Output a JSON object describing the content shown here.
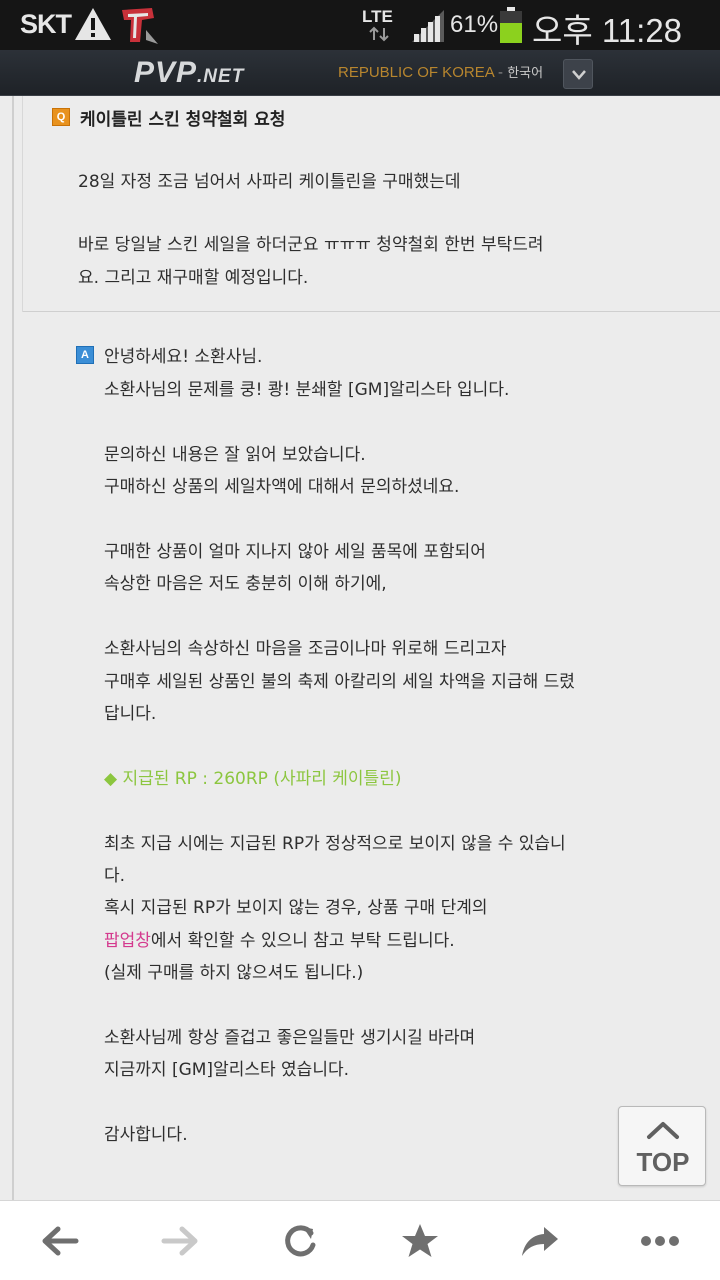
{
  "status_bar": {
    "carrier": "SKT",
    "network": "LTE",
    "battery_percent": "61%",
    "time": "오후 11:28"
  },
  "site_header": {
    "logo_main": "PVP",
    "logo_sub": ".NET",
    "region": "REPUBLIC OF KOREA",
    "separator": " - ",
    "language": "한국어"
  },
  "question": {
    "icon_letter": "Q",
    "title": "케이틀린 스킨 청약철회 요청",
    "paragraphs": [
      "28일 자정 조금 넘어서 사파리 케이틀린을 구매했는데",
      "바로 당일날 스킨 세일을 하더군요 ㅠㅠㅠ 청약철회 한번 부탁드려",
      "요. 그리고 재구매할 예정입니다."
    ]
  },
  "answer": {
    "icon_letter": "A",
    "greeting": "안녕하세요! 소환사님.",
    "lines": {
      "l1": "소환사님의 문제를 쿵! 쾅! 분쇄할 [GM]알리스타 입니다.",
      "l2": "문의하신 내용은 잘 읽어 보았습니다.",
      "l3": "구매하신 상품의 세일차액에 대해서 문의하셨네요.",
      "l4": "구매한 상품이 얼마 지나지 않아 세일 품목에 포함되어",
      "l5": "속상한 마음은 저도 충분히 이해 하기에,",
      "l6": "소환사님의 속상하신 마음을 조금이나마 위로해 드리고자",
      "l7": "구매후 세일된 상품인 불의 축제 아칼리의 세일 차액을 지급해 드렸",
      "l8": "답니다.",
      "highlight": "◆ 지급된 RP : 260RP (사파리 케이틀린)",
      "l9": "최초 지급 시에는 지급된 RP가 정상적으로 보이지 않을 수 있습니",
      "l10": "다.",
      "l11": "혹시 지급된 RP가 보이지 않는 경우, 상품 구매 단계의",
      "popup_word": "팝업창",
      "l12_rest": "에서 확인할 수 있으니 참고 부탁 드립니다.",
      "l13": "(실제 구매를 하지 않으셔도 됩니다.)",
      "l14": "소환사님께 항상 즐겁고 좋은일들만 생기시길 바라며",
      "l15": "지금까지 [GM]알리스타 였습니다.",
      "l16": "감사합니다."
    },
    "highlight_color": "#8cc63f",
    "link_color": "#d43a8e"
  },
  "top_button": {
    "label": "TOP"
  },
  "browser_nav": {
    "back": "back-arrow-icon",
    "forward": "forward-arrow-icon",
    "refresh": "refresh-icon",
    "bookmark": "star-icon",
    "share": "share-icon",
    "more": "more-dots-icon"
  }
}
